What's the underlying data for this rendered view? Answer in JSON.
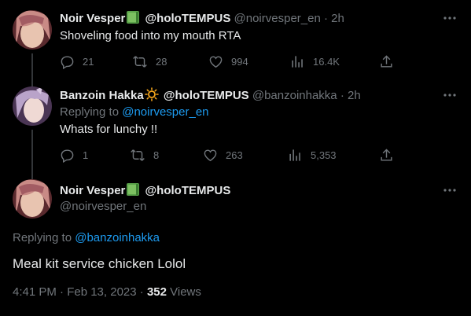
{
  "tweets": [
    {
      "name": "Noir Vesper",
      "org": "@holoTEMPUS",
      "handle": "@noirvesper_en",
      "dot": "·",
      "time": "2h",
      "text": "Shoveling food into my mouth RTA",
      "stats": {
        "replies": "21",
        "retweets": "28",
        "likes": "994",
        "views": "16.4K"
      },
      "emoji": "green-book-icon"
    },
    {
      "name": "Banzoin Hakka",
      "org": "@holoTEMPUS",
      "handle": "@banzoinhakka",
      "dot": "·",
      "time": "2h",
      "replying_prefix": "Replying to ",
      "replying_to": "@noirvesper_en",
      "text": "Whats for lunchy !!",
      "stats": {
        "replies": "1",
        "retweets": "8",
        "likes": "263",
        "views": "5,353"
      },
      "emoji": "sun-icon"
    }
  ],
  "main": {
    "name": "Noir Vesper",
    "org": "@holoTEMPUS",
    "handle": "@noirvesper_en",
    "replying_prefix": "Replying to ",
    "replying_to": "@banzoinhakka",
    "text": "Meal kit service chicken Lolol",
    "timestamp": "4:41 PM · Feb 13, 2023 · ",
    "views_count": "352",
    "views_label": " Views",
    "emoji": "green-book-icon"
  },
  "colors": {
    "background": "#000000",
    "text": "#e7e9ea",
    "muted": "#71767b",
    "link": "#1d9bf0",
    "connector": "#333639"
  }
}
